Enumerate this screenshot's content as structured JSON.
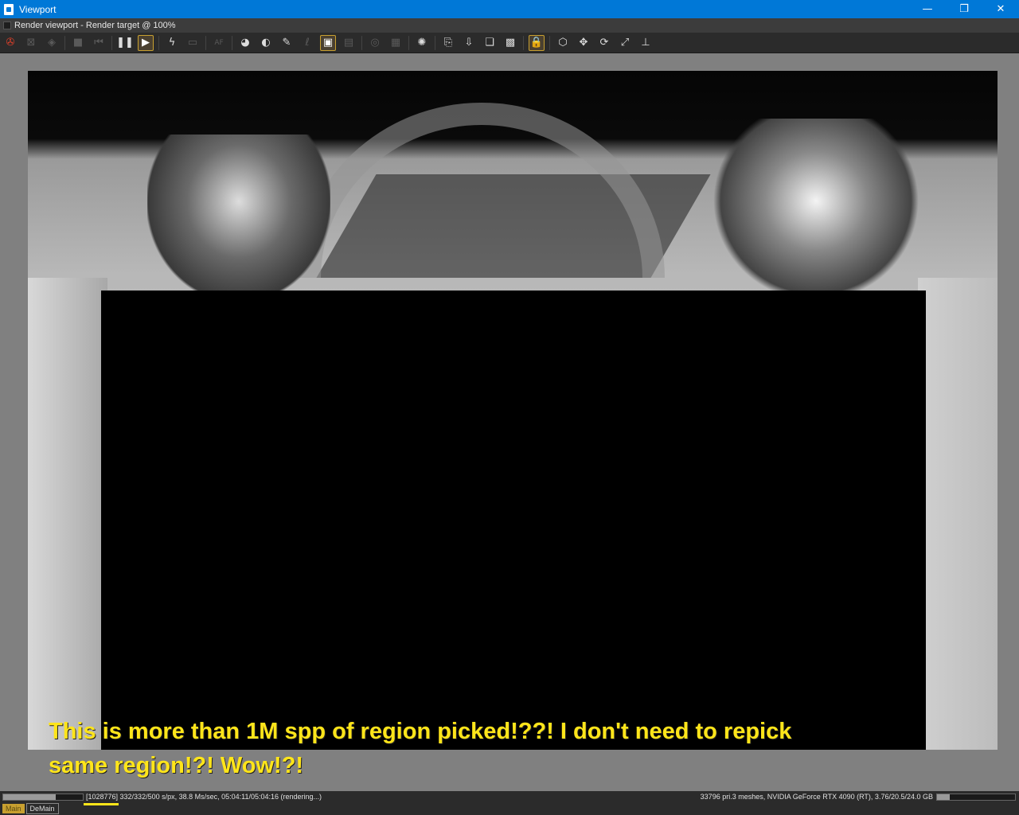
{
  "window": {
    "title": "Viewport",
    "subtitle": "Render viewport - Render target @ 100%"
  },
  "window_controls": {
    "minimize": "—",
    "maximize": "❐",
    "close": "✕"
  },
  "toolbar": {
    "icons": [
      {
        "name": "reset-icon",
        "glyph": "✇",
        "state": "red"
      },
      {
        "name": "link-icon",
        "glyph": "⊠",
        "state": "dim"
      },
      {
        "name": "cube-icon",
        "glyph": "◈",
        "state": "dim"
      },
      {
        "name": "stop-icon",
        "glyph": "■",
        "state": "dim"
      },
      {
        "name": "restart-icon",
        "glyph": "⏮",
        "state": "dim"
      },
      {
        "name": "pause-icon",
        "glyph": "❚❚",
        "state": "normal"
      },
      {
        "name": "play-icon",
        "glyph": "▶",
        "state": "active"
      },
      {
        "name": "lightning-icon",
        "glyph": "ϟ",
        "state": "normal"
      },
      {
        "name": "display-icon",
        "glyph": "▭",
        "state": "dim"
      },
      {
        "name": "af-icon",
        "glyph": "AF",
        "state": "dim"
      },
      {
        "name": "color-wheel-icon",
        "glyph": "◕",
        "state": "normal"
      },
      {
        "name": "camera-icon",
        "glyph": "◐",
        "state": "normal"
      },
      {
        "name": "brush-icon",
        "glyph": "✎",
        "state": "normal"
      },
      {
        "name": "ai-icon",
        "glyph": "ℓ",
        "state": "dim"
      },
      {
        "name": "region-select-icon",
        "glyph": "▣",
        "state": "active"
      },
      {
        "name": "film-icon",
        "glyph": "▤",
        "state": "dim"
      },
      {
        "name": "focus-icon",
        "glyph": "◎",
        "state": "dim"
      },
      {
        "name": "checker-icon",
        "glyph": "▦",
        "state": "dim"
      },
      {
        "name": "spinner-icon",
        "glyph": "✺",
        "state": "normal"
      },
      {
        "name": "copy-icon",
        "glyph": "⎘",
        "state": "normal"
      },
      {
        "name": "export-icon",
        "glyph": "⇩",
        "state": "normal"
      },
      {
        "name": "layers-icon",
        "glyph": "❏",
        "state": "normal"
      },
      {
        "name": "background-icon",
        "glyph": "▩",
        "state": "normal"
      },
      {
        "name": "lock-icon",
        "glyph": "🔒",
        "state": "active"
      },
      {
        "name": "box-icon",
        "glyph": "⬡",
        "state": "normal"
      },
      {
        "name": "move-icon",
        "glyph": "✥",
        "state": "normal"
      },
      {
        "name": "rotate-icon",
        "glyph": "⟳",
        "state": "normal"
      },
      {
        "name": "fit-icon",
        "glyph": "⤢",
        "state": "normal"
      },
      {
        "name": "axis-icon",
        "glyph": "⊥",
        "state": "normal"
      }
    ]
  },
  "overlay": {
    "line1": "This is more than 1M spp of region picked!??! I don't need to repick",
    "line2": "same region!?! Wow!?!"
  },
  "status": {
    "left": "[1028776] 332/332/500 s/px, 38.8 Ms/sec, 05:04:11/05:04:16 (rendering...)",
    "right": "33796 pri.3 meshes, NVIDIA GeForce RTX 4090 (RT), 3.76/20.5/24.0 GB",
    "progress_left": 0.66,
    "progress_right": 0.16
  },
  "tabs": [
    {
      "label": "Main",
      "active": true
    },
    {
      "label": "DeMain",
      "active": false
    }
  ],
  "colors": {
    "accent": "#0078d7",
    "highlight": "#ffe51a",
    "active_border": "#c8a030"
  }
}
